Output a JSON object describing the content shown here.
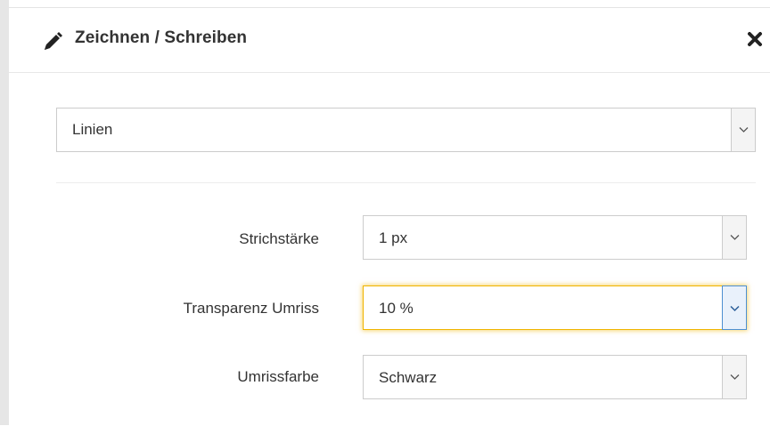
{
  "dialog": {
    "title": "Zeichnen / Schreiben",
    "title_icon": "pencil-icon",
    "close_icon": "close-icon"
  },
  "mode_select": {
    "value": "Linien"
  },
  "fields": [
    {
      "label": "Strichstärke",
      "value": "1 px",
      "focused": false
    },
    {
      "label": "Transparenz Umriss",
      "value": "10 %",
      "focused": true
    },
    {
      "label": "Umrissfarbe",
      "value": "Schwarz",
      "focused": false
    }
  ],
  "colors": {
    "text": "#333333",
    "border": "#cccccc",
    "focus_outline": "#f0b400",
    "focus_arrow_border": "#4d8fd1",
    "arrow_bg": "#f4f4f4"
  }
}
